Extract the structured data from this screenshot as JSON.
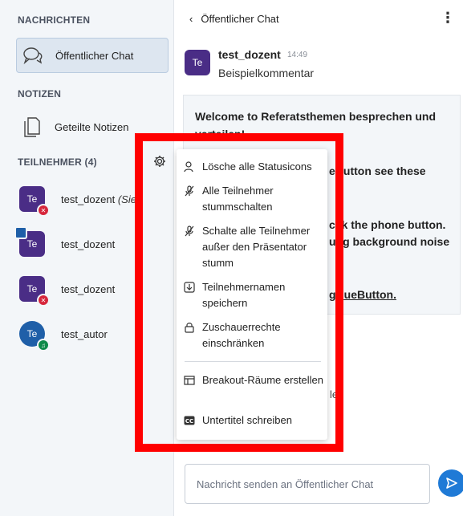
{
  "sidebar": {
    "messages_title": "NACHRICHTEN",
    "public_chat": "Öffentlicher Chat",
    "notes_title": "NOTIZEN",
    "shared_notes": "Geteilte Notizen",
    "participants_title": "TEILNEHMER (4)",
    "participants": [
      {
        "initials": "Te",
        "name": "test_dozent",
        "suffix": " (Sie)",
        "badge": "muted"
      },
      {
        "initials": "Te",
        "name": "test_dozent",
        "suffix": "",
        "badge": "presenter"
      },
      {
        "initials": "Te",
        "name": "test_dozent",
        "suffix": "",
        "badge": "muted"
      },
      {
        "initials": "Te",
        "name": "test_autor",
        "suffix": "",
        "badge": "listen"
      }
    ]
  },
  "chat": {
    "header": "Öffentlicher Chat",
    "message": {
      "initials": "Te",
      "author": "test_dozent",
      "time": "14:49",
      "text": "Beispielkommentar"
    },
    "welcome_lines": {
      "l1a": "Welcome to ",
      "l1b": "Referatsthemen besprechen und",
      "l2": "verteilen!",
      "l3": "eButton see these",
      "l4": "cli",
      "l4b": "k the phone button.",
      "l5": "u",
      "l5b": "ng background noise",
      "l6": "gB",
      "l6b": "ueButton."
    },
    "partial_text": "ler",
    "composer_placeholder": "Nachricht senden an Öffentlicher Chat"
  },
  "menu": {
    "items": [
      {
        "label": "Lösche alle Statusicons",
        "icon": "clear-status-icon"
      },
      {
        "label": "Alle Teilnehmer stummschalten",
        "icon": "mute-icon"
      },
      {
        "label": "Schalte alle Teilnehmer außer den Präsentator stumm",
        "icon": "mute-icon"
      },
      {
        "label": "Teilnehmernamen speichern",
        "icon": "download-icon"
      },
      {
        "label": "Zuschauerrechte einschränken",
        "icon": "lock-icon"
      },
      {
        "label": "Breakout-Räume erstellen",
        "icon": "rooms-icon"
      },
      {
        "label": "Untertitel schreiben",
        "icon": "closed-caption-icon"
      }
    ]
  },
  "colors": {
    "highlight": "#ff0000",
    "avatar": "#4a2d86",
    "accent": "#1f7ad6"
  }
}
